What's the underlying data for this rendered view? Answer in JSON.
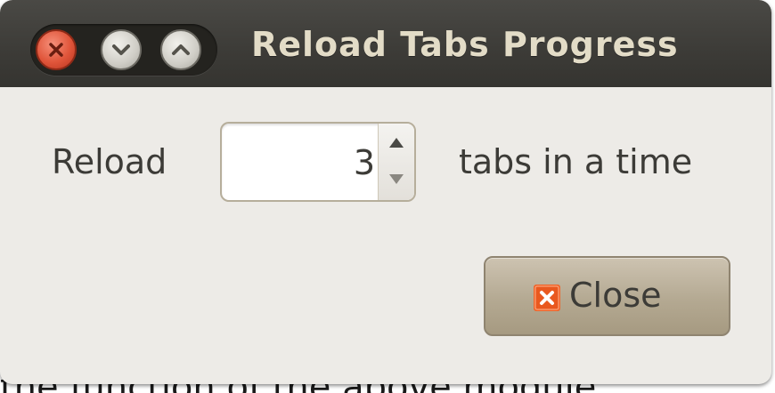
{
  "window": {
    "title": "Reload Tabs Progress",
    "controls": [
      "close-icon",
      "minimize-icon",
      "maximize-icon"
    ]
  },
  "form": {
    "reload_label": "Reload",
    "tabs_count": "3",
    "tabs_label": "tabs in a time"
  },
  "buttons": {
    "close_label": "Close",
    "close_icon": "close-icon"
  },
  "background": {
    "partial_text": "the function of the above module"
  },
  "colors": {
    "titlebar": "#3c3b37",
    "title_text": "#e3dcc7",
    "window_bg": "#edebe7",
    "close_accent": "#e0553a",
    "button_bg": "#b4a992"
  }
}
